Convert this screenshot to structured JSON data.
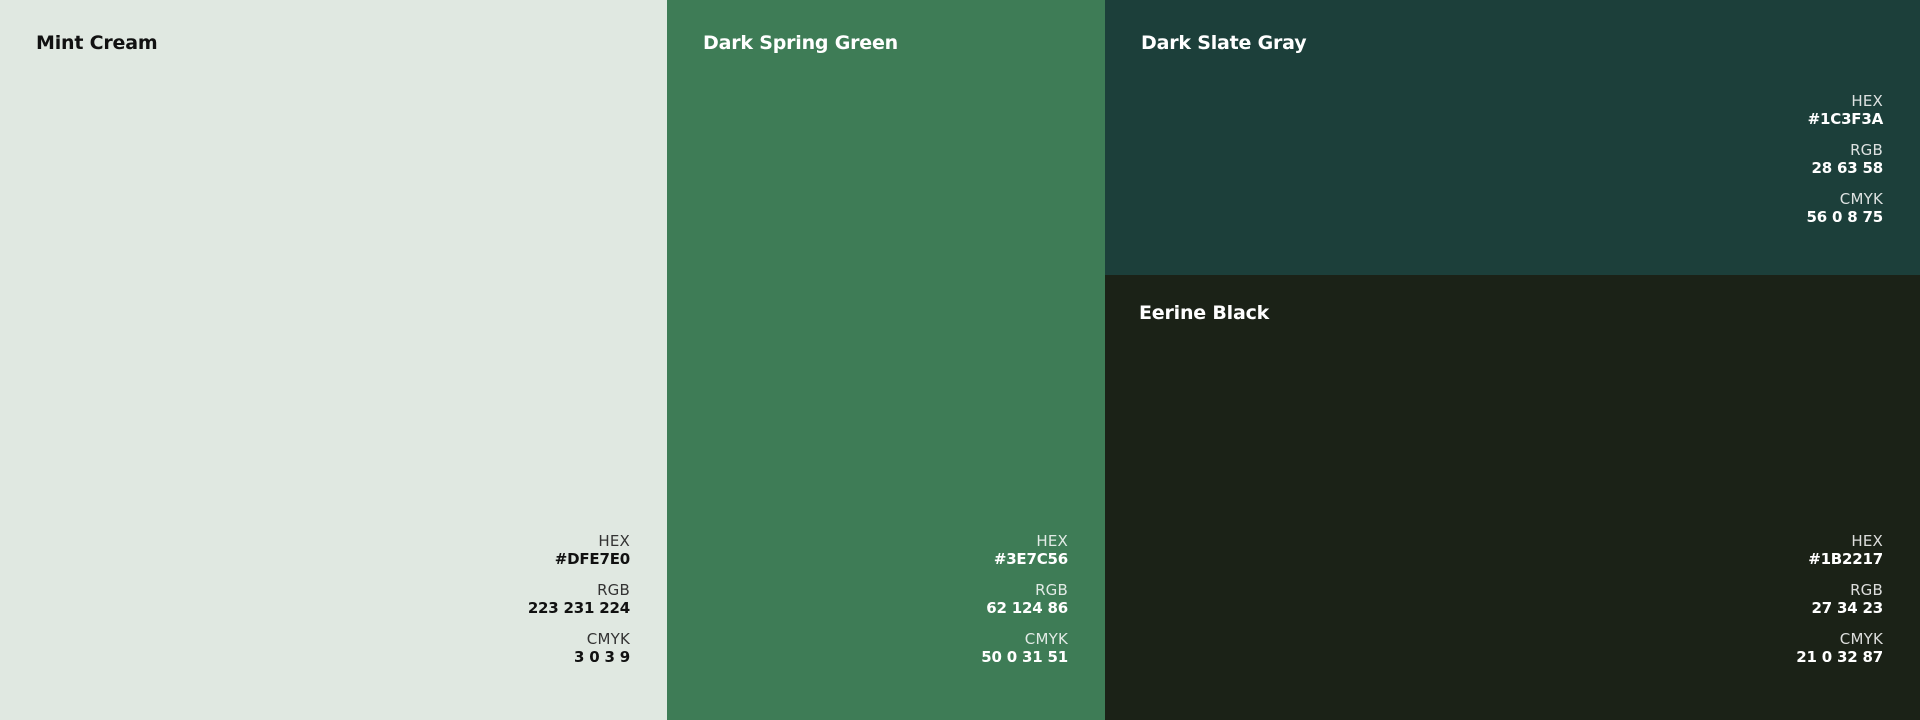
{
  "swatches": [
    {
      "name": "Mint Cream",
      "color": "#DFE7E0",
      "hex_label": "HEX",
      "hex": "#DFE7E0",
      "rgb_label": "RGB",
      "rgb": "223 231 224",
      "cmyk_label": "CMYK",
      "cmyk": "3 0 3 9"
    },
    {
      "name": "Dark Spring Green",
      "color": "#3E7C56",
      "hex_label": "HEX",
      "hex": "#3E7C56",
      "rgb_label": "RGB",
      "rgb": "62 124 86",
      "cmyk_label": "CMYK",
      "cmyk": "50 0 31 51"
    },
    {
      "name": "Dark Slate Gray",
      "color": "#1C3F3A",
      "hex_label": "HEX",
      "hex": "#1C3F3A",
      "rgb_label": "RGB",
      "rgb": "28 63 58",
      "cmyk_label": "CMYK",
      "cmyk": "56 0 8 75"
    },
    {
      "name": "Eerine Black",
      "color": "#1B2217",
      "hex_label": "HEX",
      "hex": "#1B2217",
      "rgb_label": "RGB",
      "rgb": "27 34 23",
      "cmyk_label": "CMYK",
      "cmyk": "21 0 32 87"
    }
  ]
}
